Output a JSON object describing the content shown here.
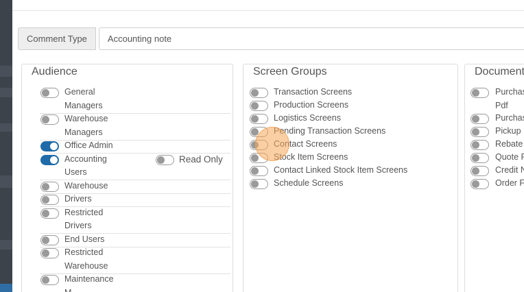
{
  "comment": {
    "type_label": "Comment Type",
    "type_value": "Accounting note"
  },
  "audience": {
    "title": "Audience",
    "read_only_label": "Read Only",
    "items": [
      {
        "label": [
          "General",
          "Managers"
        ],
        "on": false
      },
      {
        "label": [
          "Warehouse",
          "Managers"
        ],
        "on": false
      },
      {
        "label": [
          "Office Admin"
        ],
        "on": true
      },
      {
        "label": [
          "Accounting",
          "Users"
        ],
        "on": true
      },
      {
        "label": [
          "Warehouse"
        ],
        "on": false
      },
      {
        "label": [
          "Drivers"
        ],
        "on": false
      },
      {
        "label": [
          "Restricted",
          "Drivers"
        ],
        "on": false
      },
      {
        "label": [
          "End Users"
        ],
        "on": false
      },
      {
        "label": [
          "Restricted",
          "Warehouse"
        ],
        "on": false
      },
      {
        "label": [
          "Maintenance",
          "M"
        ],
        "on": false
      }
    ]
  },
  "screen_groups": {
    "title": "Screen Groups",
    "items": [
      "Transaction Screens",
      "Production Screens",
      "Logistics Screens",
      "Pending Transaction Screens",
      "Contact Screens",
      "Stock Item Screens",
      "Contact Linked Stock Item Screens",
      "Schedule Screens"
    ]
  },
  "documents": {
    "title": "Document",
    "items": [
      [
        "Purchas",
        "Pdf"
      ],
      [
        "Purchas"
      ],
      [
        "Pickup I"
      ],
      [
        "Rebate"
      ],
      [
        "Quote F"
      ],
      [
        "Credit N"
      ],
      [
        "Order F"
      ]
    ]
  },
  "colors": {
    "toggle_on": "#1f6aa8",
    "toggle_off": "#9a9a9a",
    "cursor_highlight": "#f6a75a"
  }
}
